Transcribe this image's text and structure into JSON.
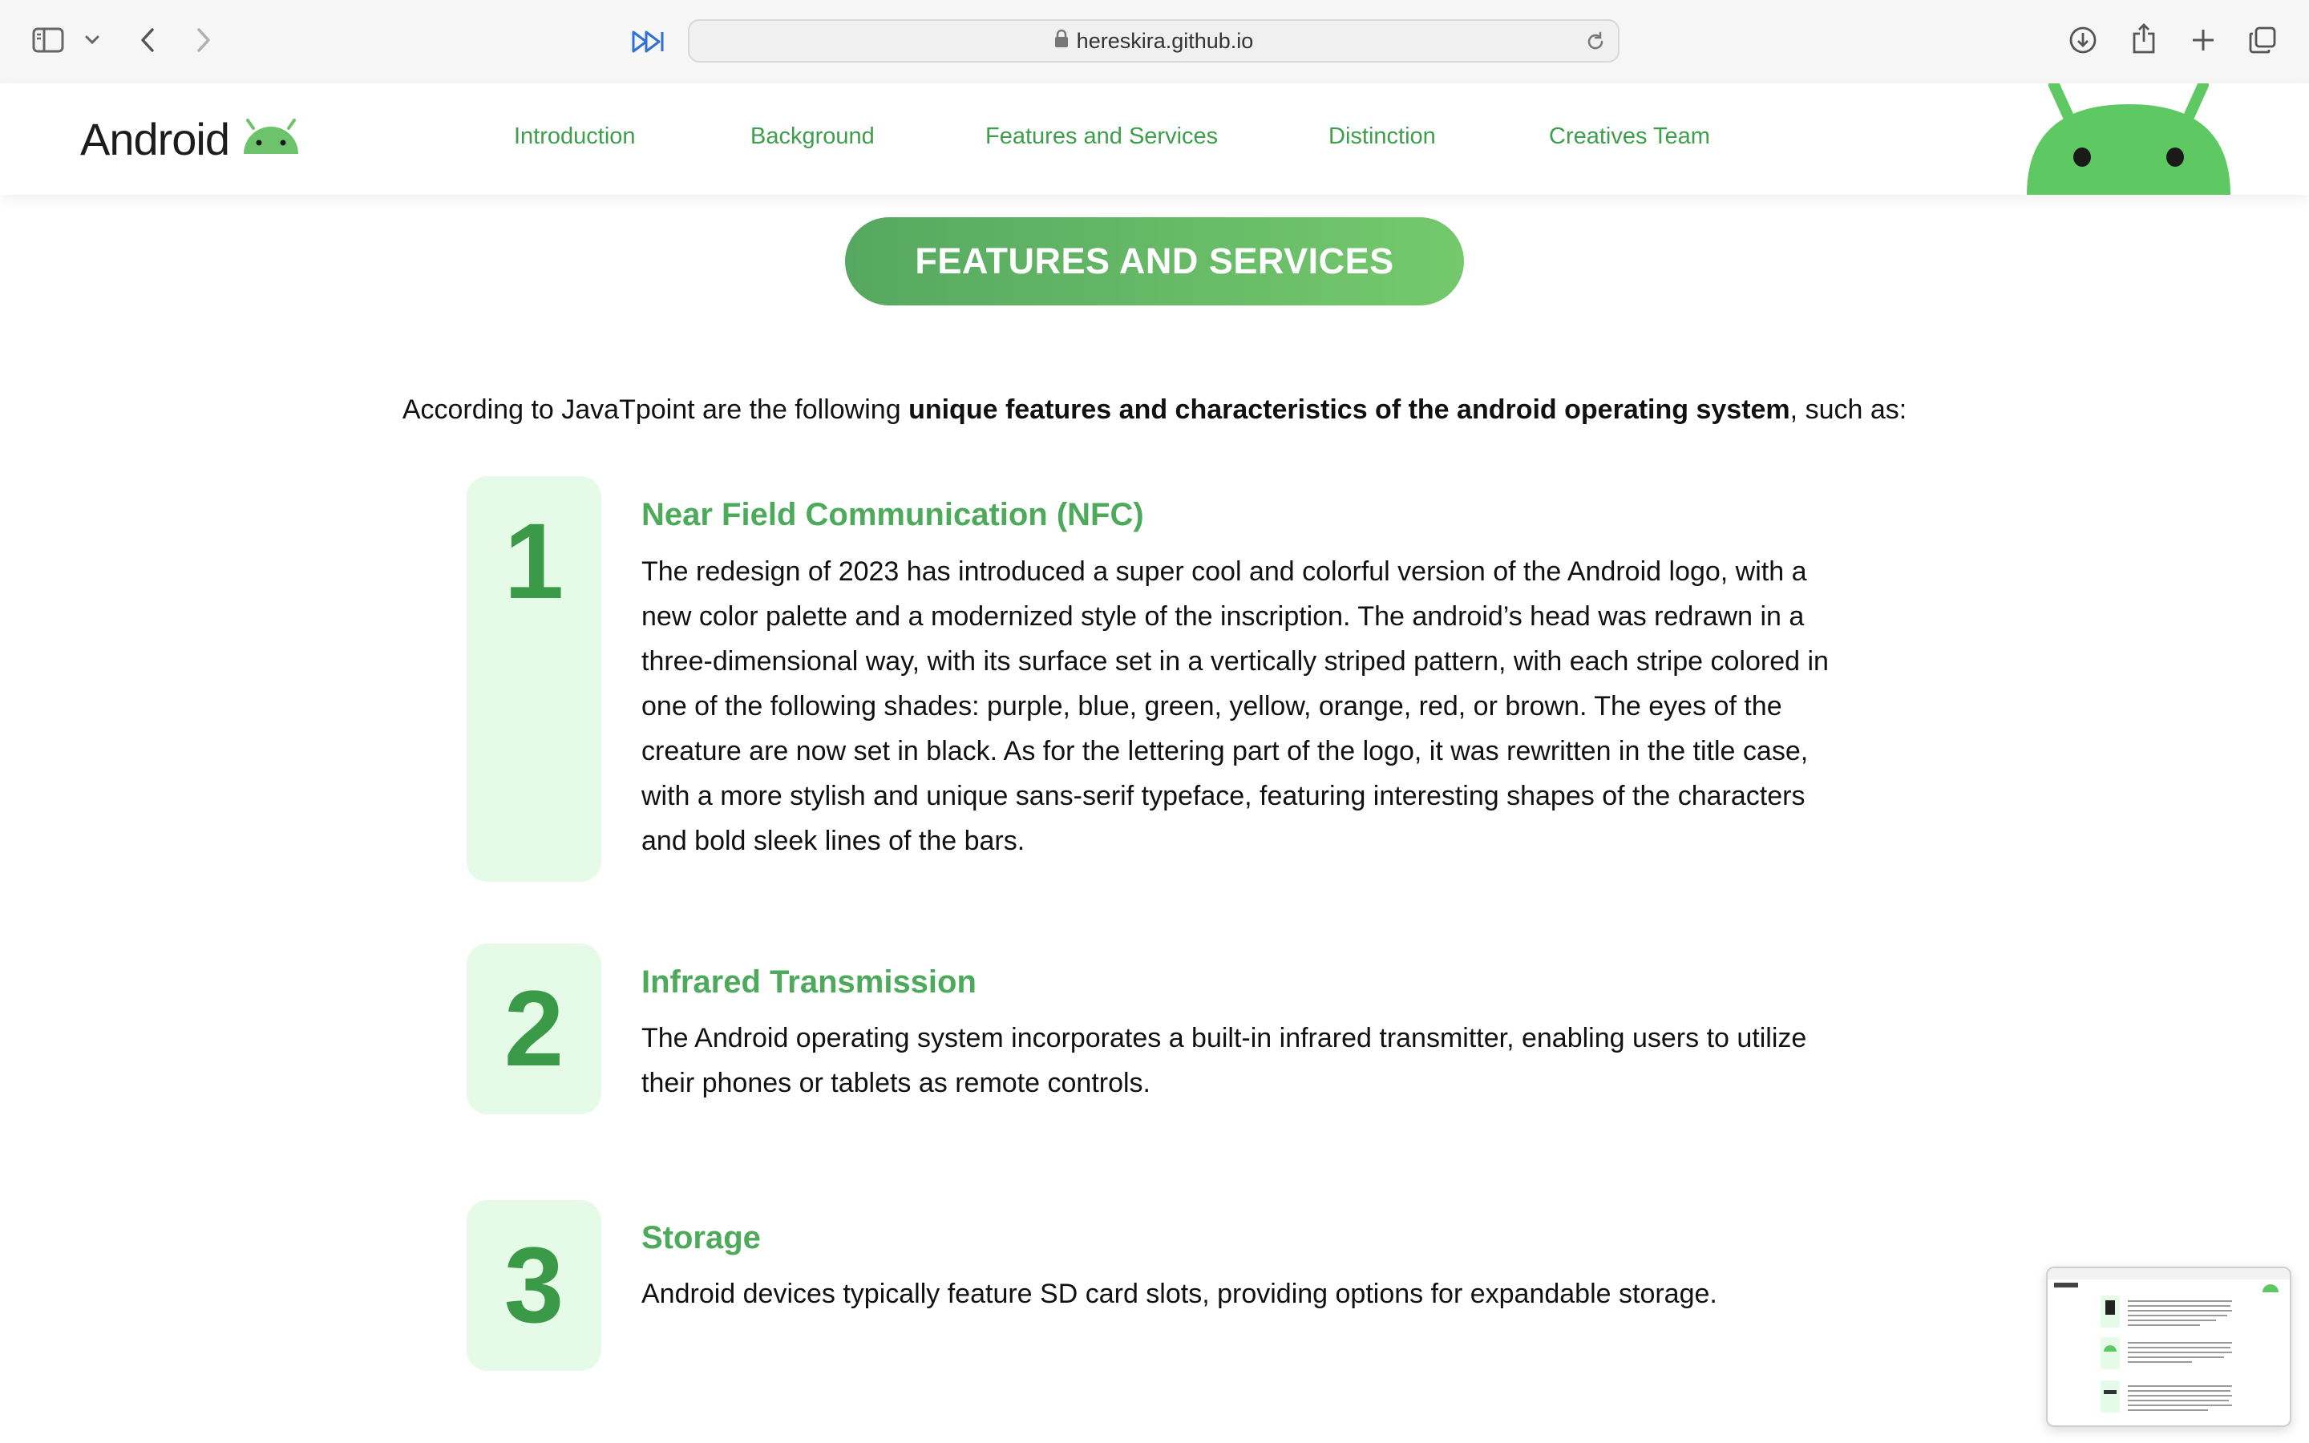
{
  "browser": {
    "url": "hereskira.github.io",
    "icons": [
      "sidebar-icon",
      "chevron-down-icon",
      "back-icon",
      "forward-icon",
      "fast-forward-icon",
      "lock-icon",
      "reload-icon",
      "download-icon",
      "share-icon",
      "new-tab-icon",
      "tabs-overview-icon"
    ]
  },
  "site": {
    "brand": "Android",
    "nav": [
      "Introduction",
      "Background",
      "Features and Services",
      "Distinction",
      "Creatives Team"
    ],
    "accent": "#3f9e4b",
    "android_green": "#5ec862"
  },
  "section": {
    "heading": "FEATURES AND SERVICES",
    "intro_prefix": "According to JavaTpoint are the following ",
    "intro_bold": "unique features and characteristics of the android operating system",
    "intro_suffix": ", such as:"
  },
  "features": [
    {
      "number": "1",
      "title": "Near Field Communication (NFC)",
      "description": "The redesign of 2023 has introduced a super cool and colorful version of the Android logo, with a new color palette and a modernized style of the inscription. The android’s head was redrawn in a three-dimensional way, with its surface set in a vertically striped pattern, with each stripe colored in one of the following shades: purple, blue, green, yellow, orange, red, or brown. The eyes of the creature are now set in black. As for the lettering part of the logo, it was rewritten in the title case, with a more stylish and unique sans-serif typeface, featuring interesting shapes of the characters and bold sleek lines of the bars."
    },
    {
      "number": "2",
      "title": "Infrared Transmission",
      "description": "The Android operating system incorporates a built-in infrared transmitter, enabling users to utilize their phones or tablets as remote controls."
    },
    {
      "number": "3",
      "title": "Storage",
      "description": "Android devices typically feature SD card slots, providing options for expandable storage."
    }
  ]
}
